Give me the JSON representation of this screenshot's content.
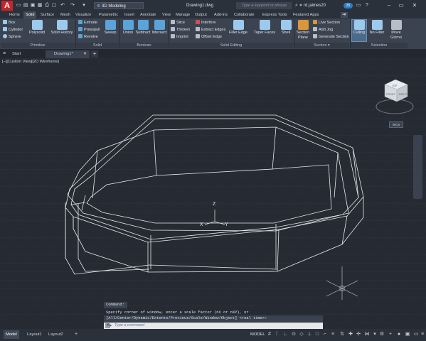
{
  "titlebar": {
    "logo": "A",
    "quick_access": [
      "new-icon",
      "open-icon",
      "save-icon",
      "saveas-icon",
      "print-icon",
      "undo-icon",
      "redo-icon"
    ],
    "workspace": "3D Modeling",
    "document_title": "Drawing1.dwg",
    "search_placeholder": "Type a keyword or phrase",
    "user": "rd.jaimes20",
    "badge": "25"
  },
  "ribbon_tabs": [
    "Home",
    "Solid",
    "Surface",
    "Mesh",
    "Visualize",
    "Parametric",
    "Insert",
    "Annotate",
    "View",
    "Manage",
    "Output",
    "Add-ins",
    "Collaborate",
    "Express Tools",
    "Featured Apps"
  ],
  "active_ribbon_tab": "Solid",
  "ribbon": {
    "primitive": {
      "title": "Primitive",
      "items": [
        "Box",
        "Cylinder",
        "Sphere"
      ],
      "large": [
        "Polysolid",
        "Solid History"
      ]
    },
    "solid": {
      "title": "Solid",
      "items": [
        "Extrude",
        "Presspull",
        "Revolve"
      ],
      "large": [
        "Sweep"
      ]
    },
    "boolean": {
      "title": "Boolean",
      "large": [
        "Union",
        "Subtract",
        "Intersect"
      ]
    },
    "solid_editing": {
      "title": "Solid Editing",
      "col1": [
        "Slice",
        "Thicken",
        "Imprint"
      ],
      "col2": [
        "Interfere",
        "Extract Edges",
        "Offset Edge"
      ],
      "large": [
        "Fillet Edge",
        "Taper Faces",
        "Shell"
      ]
    },
    "section": {
      "title": "Section",
      "large": [
        "Section Plane"
      ],
      "items": [
        "Live Section",
        "Add Jog",
        "Generate Section"
      ]
    },
    "selection": {
      "title": "Selection",
      "large": [
        "Culling",
        "No Filter",
        "Move Gizmo"
      ]
    }
  },
  "file_tabs": [
    "Start",
    "Drawing1*"
  ],
  "viewport": {
    "label": "[−][Custom View][2D Wireframe]",
    "viewcube_faces": [
      "TOP",
      "FRONT",
      "RIGHT"
    ],
    "wcs": "WCS",
    "ucs_axes": [
      "Z",
      "X",
      "Y"
    ]
  },
  "command": {
    "history": [
      "Command:",
      "Specify corner of window, enter a scale factor (nX or nXP), or",
      "[All/Center/Dynamic/Extents/Previous/Scale/Window/Object] <real time>:"
    ],
    "placeholder": "Type a command"
  },
  "status": {
    "tabs": [
      "Model",
      "Layout1",
      "Layout2"
    ],
    "active_tab": "Model",
    "model_label": "MODEL"
  },
  "colors": {
    "accent": "#5ba3d9",
    "logo": "#c4262e",
    "background": "#262b33"
  }
}
